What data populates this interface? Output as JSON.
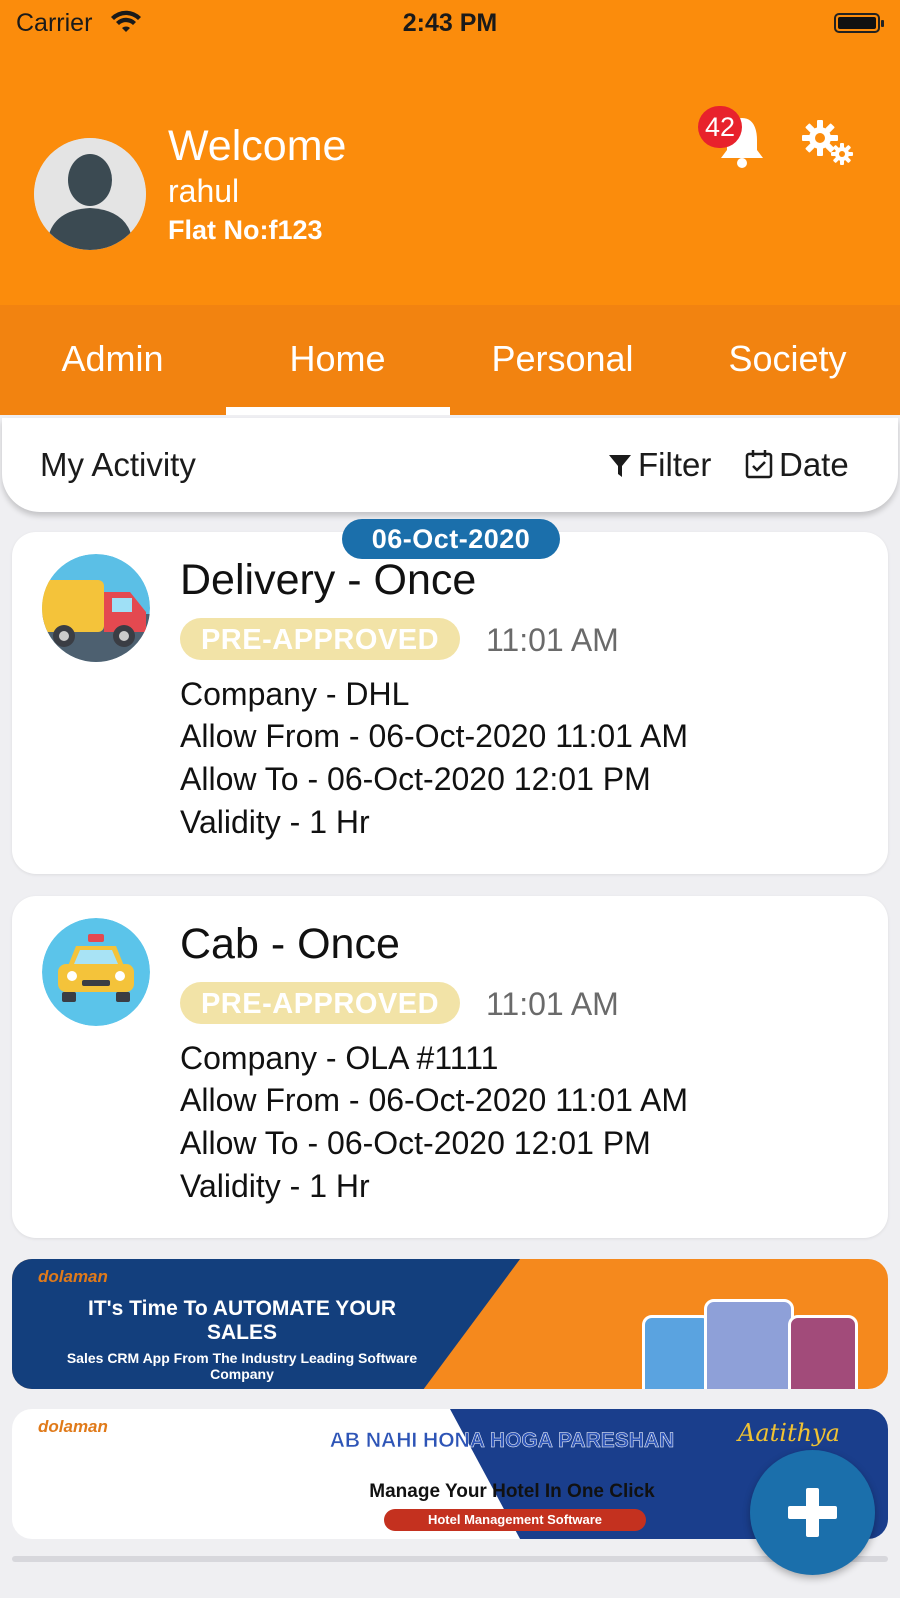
{
  "status_bar": {
    "carrier": "Carrier",
    "time": "2:43 PM"
  },
  "header": {
    "welcome": "Welcome",
    "username": "rahul",
    "flat": "Flat No:f123",
    "notification_count": "42"
  },
  "tabs": [
    {
      "label": "Admin"
    },
    {
      "label": "Home",
      "active": true
    },
    {
      "label": "Personal"
    },
    {
      "label": "Society"
    }
  ],
  "activity": {
    "title": "My Activity",
    "filter_label": "Filter",
    "date_label": "Date",
    "date_group": "06-Oct-2020"
  },
  "cards": [
    {
      "icon": "delivery-truck-icon",
      "title": "Delivery - Once",
      "status": "PRE-APPROVED",
      "time": "11:01 AM",
      "lines": [
        "Company - DHL",
        "Allow From - 06-Oct-2020 11:01 AM",
        "Allow To - 06-Oct-2020 12:01 PM",
        "Validity - 1 Hr"
      ]
    },
    {
      "icon": "taxi-cab-icon",
      "title": "Cab - Once",
      "status": "PRE-APPROVED",
      "time": "11:01 AM",
      "lines": [
        "Company - OLA #1111",
        "Allow From - 06-Oct-2020 11:01 AM",
        "Allow To - 06-Oct-2020 12:01 PM",
        "Validity - 1 Hr"
      ]
    }
  ],
  "banners": [
    {
      "logo": "dolaman",
      "headline": "IT's Time To AUTOMATE YOUR SALES",
      "subline": "Sales CRM App From The Industry Leading Software Company"
    },
    {
      "logo": "dolaman",
      "headline": "AB NAHI HONA HOGA PARESHAN",
      "subline": "Manage Your Hotel In One Click",
      "tag": "Hotel Management Software",
      "brand": "Aatithya"
    }
  ],
  "colors": {
    "header": "#fb8c0c",
    "tabs": "#f28310",
    "accent_blue": "#1b6fab",
    "status_pill": "#f2e3a7",
    "badge": "#e8222c"
  }
}
